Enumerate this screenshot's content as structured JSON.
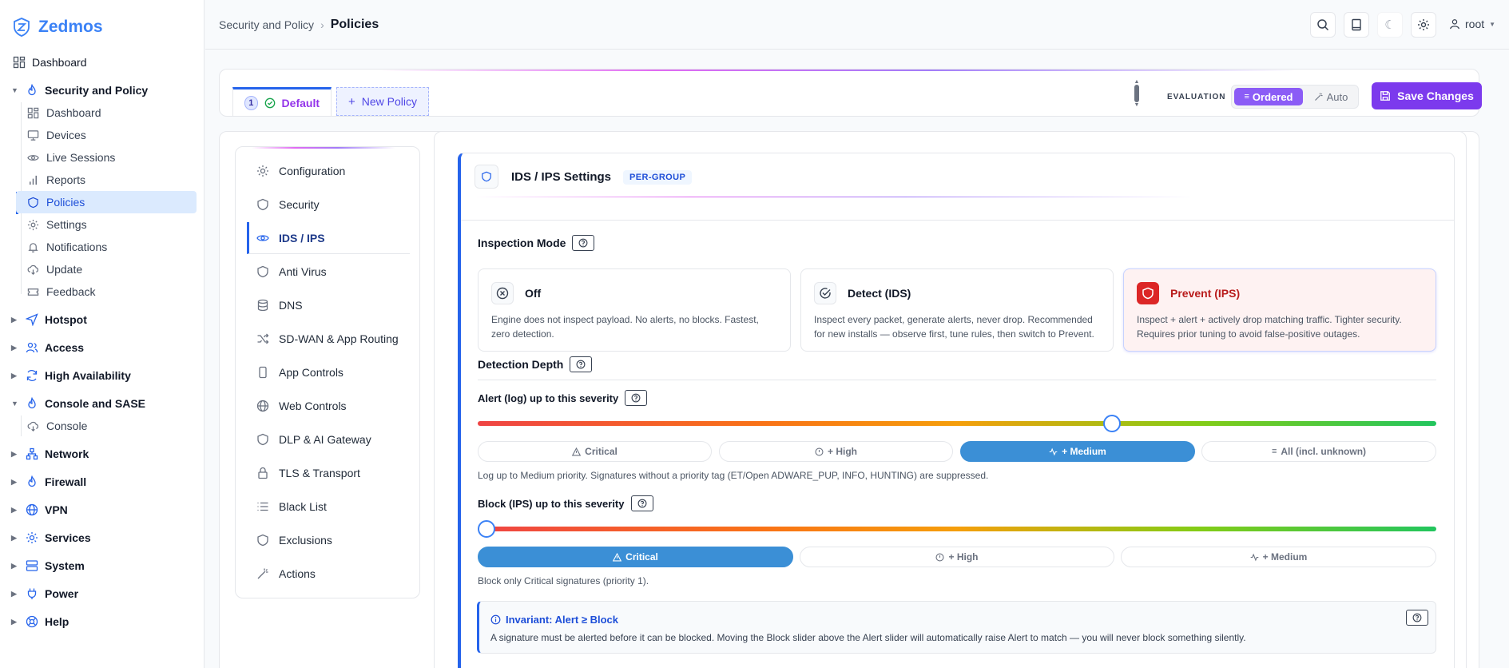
{
  "brand": {
    "name": "Zedmos"
  },
  "sidebar": {
    "dashboard": "Dashboard",
    "security_group": "Security and Policy",
    "security_items": [
      "Dashboard",
      "Devices",
      "Live Sessions",
      "Reports",
      "Policies",
      "Settings",
      "Notifications",
      "Update",
      "Feedback"
    ],
    "groups_a": [
      "Hotspot",
      "Access",
      "High Availability"
    ],
    "console_group": "Console and SASE",
    "console_item": "Console",
    "groups_b": [
      "Network",
      "Firewall",
      "VPN",
      "Services",
      "System",
      "Power",
      "Help"
    ]
  },
  "topbar": {
    "breadcrumb_parent": "Security and Policy",
    "breadcrumb_current": "Policies",
    "user": "root"
  },
  "policy_tabs": {
    "default_num": "1",
    "default_label": "Default",
    "new_label": "New Policy"
  },
  "evaluation": {
    "label": "EVALUATION",
    "ordered": "Ordered",
    "auto": "Auto"
  },
  "save_label": "Save Changes",
  "settings_menu": [
    "Configuration",
    "Security",
    "IDS / IPS",
    "Anti Virus",
    "DNS",
    "SD-WAN & App Routing",
    "App Controls",
    "Web Controls",
    "DLP & AI Gateway",
    "TLS & Transport",
    "Black List",
    "Exclusions",
    "Actions"
  ],
  "panel": {
    "title": "IDS / IPS Settings",
    "badge": "PER-GROUP",
    "inspection_mode": "Inspection Mode",
    "modes": [
      {
        "title": "Off",
        "desc": "Engine does not inspect payload. No alerts, no blocks. Fastest, zero detection."
      },
      {
        "title": "Detect (IDS)",
        "desc": "Inspect every packet, generate alerts, never drop. Recommended for new installs — observe first, tune rules, then switch to Prevent."
      },
      {
        "title": "Prevent (IPS)",
        "desc": "Inspect + alert + actively drop matching traffic. Tighter security. Requires prior tuning to avoid false-positive outages."
      }
    ],
    "selected_mode": "Prevent (IPS)",
    "detection_depth": "Detection Depth",
    "alert_title": "Alert (log) up to this severity",
    "alert_options": [
      "Critical",
      "+ High",
      "+ Medium",
      "All (incl. unknown)"
    ],
    "alert_selected": "+ Medium",
    "alert_level": 0.665,
    "alert_hint": "Log up to Medium priority. Signatures without a priority tag (ET/Open ADWARE_PUP, INFO, HUNTING) are suppressed.",
    "block_title": "Block (IPS) up to this severity",
    "block_options": [
      "Critical",
      "+ High",
      "+ Medium"
    ],
    "block_selected": "Critical",
    "block_level": 0.0,
    "block_hint": "Block only Critical signatures (priority 1).",
    "invariant_title": "Invariant: Alert ≥ Block",
    "invariant_text": "A signature must be alerted before it can be blocked. Moving the Block slider above the Alert slider will automatically raise Alert to match — you will never block something silently."
  },
  "colors": {
    "accent": "#2563eb",
    "brand": "#3b82f6",
    "save": "#7c3aed",
    "danger": "#dc2626",
    "selected_pill": "#3b8fd6"
  }
}
